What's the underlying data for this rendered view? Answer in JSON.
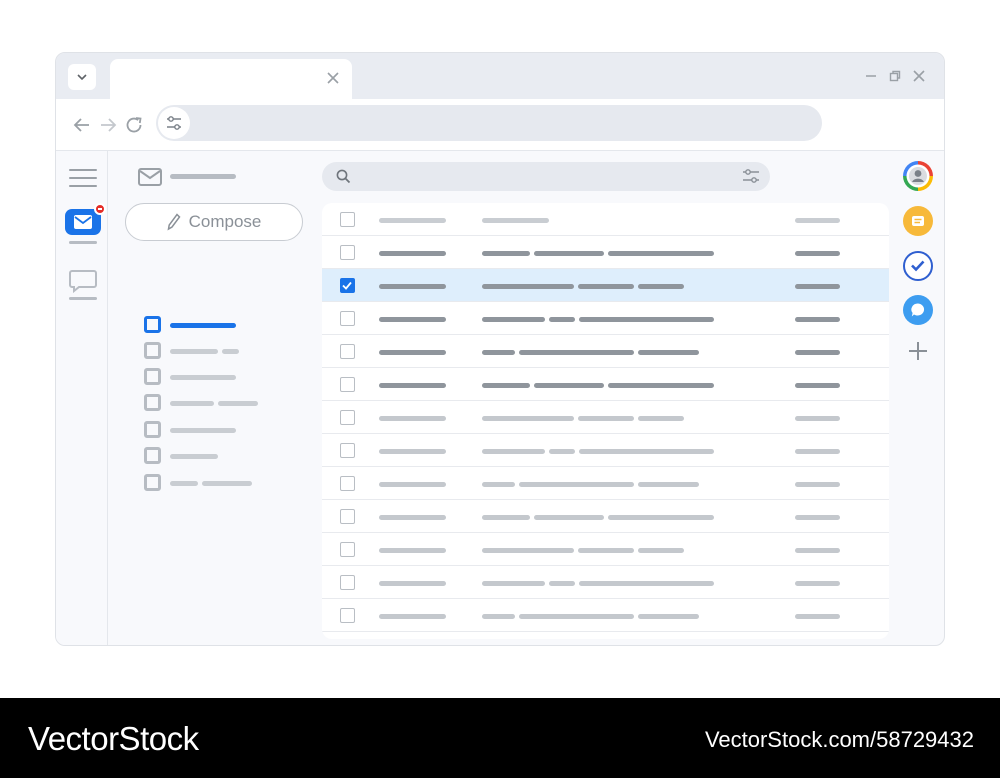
{
  "compose": {
    "label": "Compose"
  },
  "icons": {
    "tab_menu": "chevron-down-icon",
    "tab_close": "close-icon",
    "back": "arrow-left-icon",
    "forward": "arrow-right-icon",
    "reload": "reload-icon",
    "site_settings": "tune-icon",
    "search": "search-icon",
    "search_filter": "tune-icon",
    "menu": "hamburger-icon",
    "mail": "mail-icon",
    "chat": "chat-icon",
    "compose": "pencil-icon",
    "account": "account-icon",
    "keep": "keep-icon",
    "tasks": "tasks-icon",
    "messages": "message-icon",
    "add": "plus-icon"
  },
  "colors": {
    "accent": "#1a73e8",
    "badge": "#e52d27",
    "selected_row": "#deeefc",
    "keep": "#f7b93a",
    "tasks": "#2f5fd0",
    "messages": "#3d9df0"
  },
  "rows": [
    {
      "checked": false
    },
    {
      "checked": false
    },
    {
      "checked": true
    },
    {
      "checked": false
    },
    {
      "checked": false
    },
    {
      "checked": false
    },
    {
      "checked": false
    },
    {
      "checked": false
    },
    {
      "checked": false
    },
    {
      "checked": false
    },
    {
      "checked": false
    },
    {
      "checked": false
    },
    {
      "checked": false
    }
  ],
  "sidebar": {
    "active_index": 0
  }
}
